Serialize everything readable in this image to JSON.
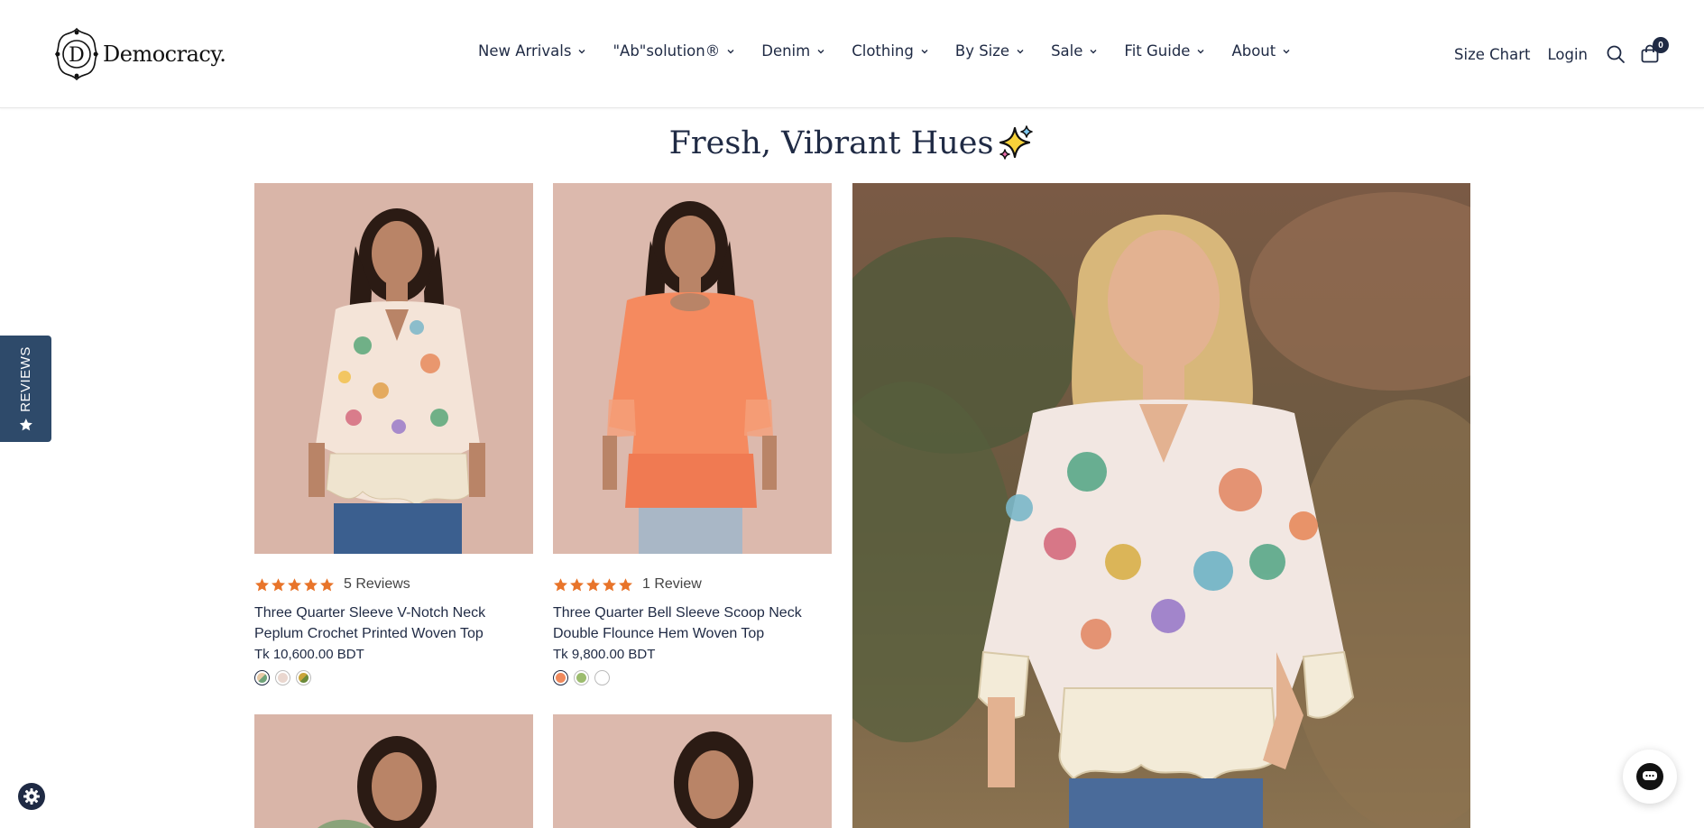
{
  "header": {
    "logo_text": "Democracy.",
    "logo_initial": "D",
    "nav": [
      {
        "label": "New Arrivals"
      },
      {
        "label": "\"Ab\"solution®"
      },
      {
        "label": "Denim"
      },
      {
        "label": "Clothing"
      },
      {
        "label": "By Size"
      },
      {
        "label": "Sale"
      },
      {
        "label": "Fit Guide"
      },
      {
        "label": "About"
      }
    ],
    "size_chart_label": "Size Chart",
    "login_label": "Login",
    "cart_count": "0"
  },
  "section": {
    "title": "Fresh, Vibrant Hues"
  },
  "products": [
    {
      "reviews": "5 Reviews",
      "rating": 5,
      "title": "Three Quarter Sleeve V-Notch Neck Peplum Crochet Printed Woven Top",
      "price": "Tk 10,600.00 BDT",
      "swatches": [
        "#e8c9a6",
        "#ead7cf",
        "#c9a43a"
      ]
    },
    {
      "reviews": "1 Review",
      "rating": 5,
      "title": "Three Quarter Bell Sleeve Scoop Neck Double Flounce Hem Woven Top",
      "price": "Tk 9,800.00 BDT",
      "swatches": [
        "#f08a5d",
        "#9cbc6e",
        "#ffffff"
      ]
    }
  ],
  "reviews_tab": {
    "label": "REVIEWS"
  },
  "colors": {
    "navy": "#1f2a44",
    "star": "#e8742a",
    "reviews_tab_bg": "#2e4a6a",
    "product_bg": "#d9b5a8"
  }
}
